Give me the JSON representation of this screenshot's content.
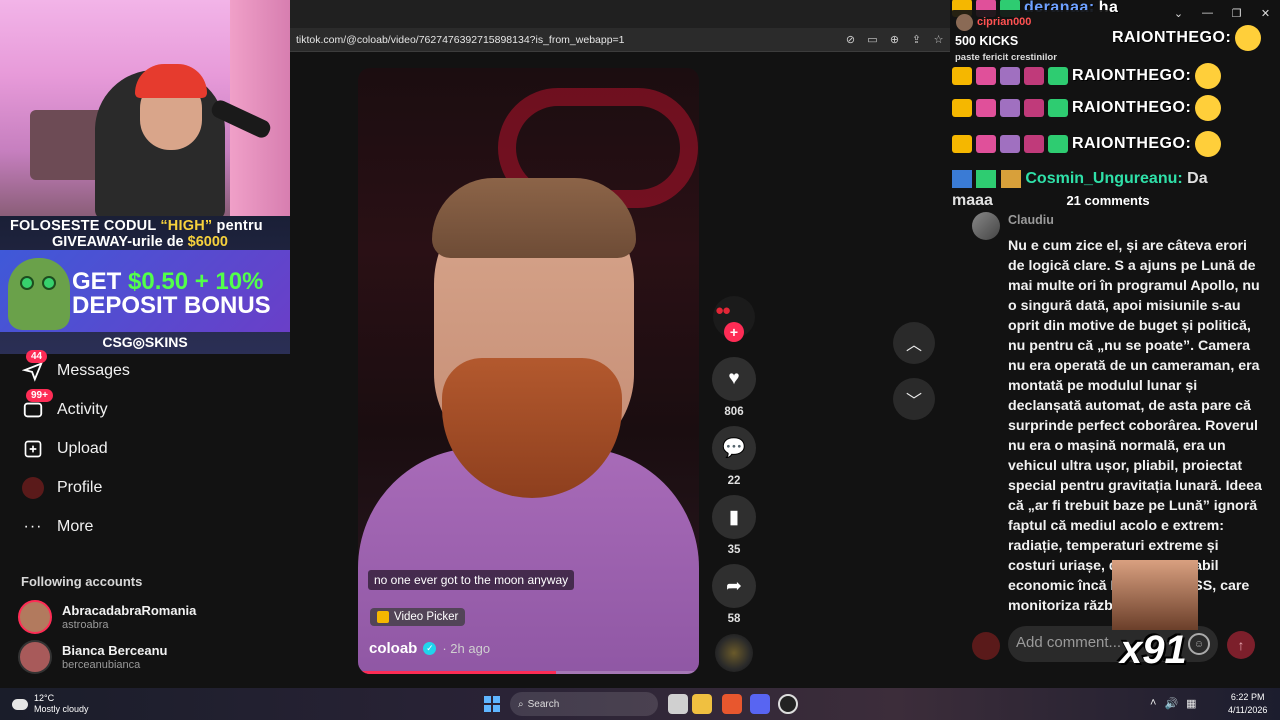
{
  "overlay": {
    "promo_code_line_prefix": "FOLOSESTE CODUL ",
    "promo_code": "“HIGH”",
    "promo_code_line_suffix": " pentru",
    "giveaway_prefix": "GIVEAWAY-urile de ",
    "giveaway_amount": "$6000",
    "bonus_line1_prefix": "GET ",
    "bonus_amount": "$0.50 + 10%",
    "bonus_line2": "DEPOSIT BONUS",
    "brand": "CSG◎SKINS"
  },
  "sidebar": {
    "items": [
      {
        "label": "Messages",
        "badge": "44",
        "icon": "paper-plane-icon"
      },
      {
        "label": "Activity",
        "badge": "99+",
        "icon": "inbox-icon"
      },
      {
        "label": "Upload",
        "badge": "",
        "icon": "plus-square-icon"
      },
      {
        "label": "Profile",
        "badge": "",
        "icon": "avatar-icon"
      },
      {
        "label": "More",
        "badge": "",
        "icon": "more-dots-icon"
      }
    ],
    "following_title": "Following accounts",
    "following": [
      {
        "name": "AbracadabraRomania",
        "handle": "astroabra",
        "live": "LIVE"
      },
      {
        "name": "Bianca Berceanu",
        "handle": "berceanubianca",
        "live": ""
      }
    ]
  },
  "browser": {
    "url": "tiktok.com/@coloab/video/7627476392715898134?is_from_webapp=1"
  },
  "video": {
    "subtitle": "no one ever got to the moon anyway",
    "picker_label": "Video Picker",
    "author": "coloab",
    "posted": "· 2h ago",
    "progress": 0.58,
    "likes": "806",
    "comments": "22",
    "saves": "35",
    "shares": "58"
  },
  "chat": {
    "alert_user": "ciprian000",
    "alert_title": "500 KICKS",
    "alert_message": "paste fericit crestinilor",
    "top_partial_nick": "deranaa:",
    "top_partial_text": "ha",
    "repeat_nick": "RAIONTHEGO:",
    "cosmin_nick": "Cosmin_Ungureanu:",
    "cosmin_text": "Da maaa"
  },
  "comments": {
    "count_label": "21 comments",
    "items": [
      {
        "author": "Claudiu",
        "text": "Nu e cum zice el, și are câteva erori de logică clare. S a ajuns pe Lună de mai multe ori în programul Apollo, nu o singură dată, apoi misiunile s-au oprit din motive de buget și politică, nu pentru că „nu se poate”. Camera nu era operată de un cameraman, era montată pe modulul lunar și declanșată automat, de asta pare că surprinde perfect coborârea. Roverul nu era o mașină normală, era un vehicul ultra ușor, pliabil, proiectat special pentru gravitația lunară. Ideea că „ar fi trebuit baze pe Lună” ignoră faptul că mediul acolo e extrem: radiație, temperaturi extreme și costuri uriașe, deși nu e fezabil economic încă Da, fake, URSS, care monitoriza războiul"
      }
    ],
    "add_placeholder": "Add comment..."
  },
  "gif_overlay": {
    "label": "x91"
  },
  "taskbar": {
    "temp": "12°C",
    "weather": "Mostly cloudy",
    "search_label": "Search",
    "time": "6:22 PM",
    "date": "4/11/2026"
  },
  "colors": {
    "accent": "#fe2c55",
    "verified": "#20d5ec",
    "chat_green": "#2fe0a8"
  }
}
